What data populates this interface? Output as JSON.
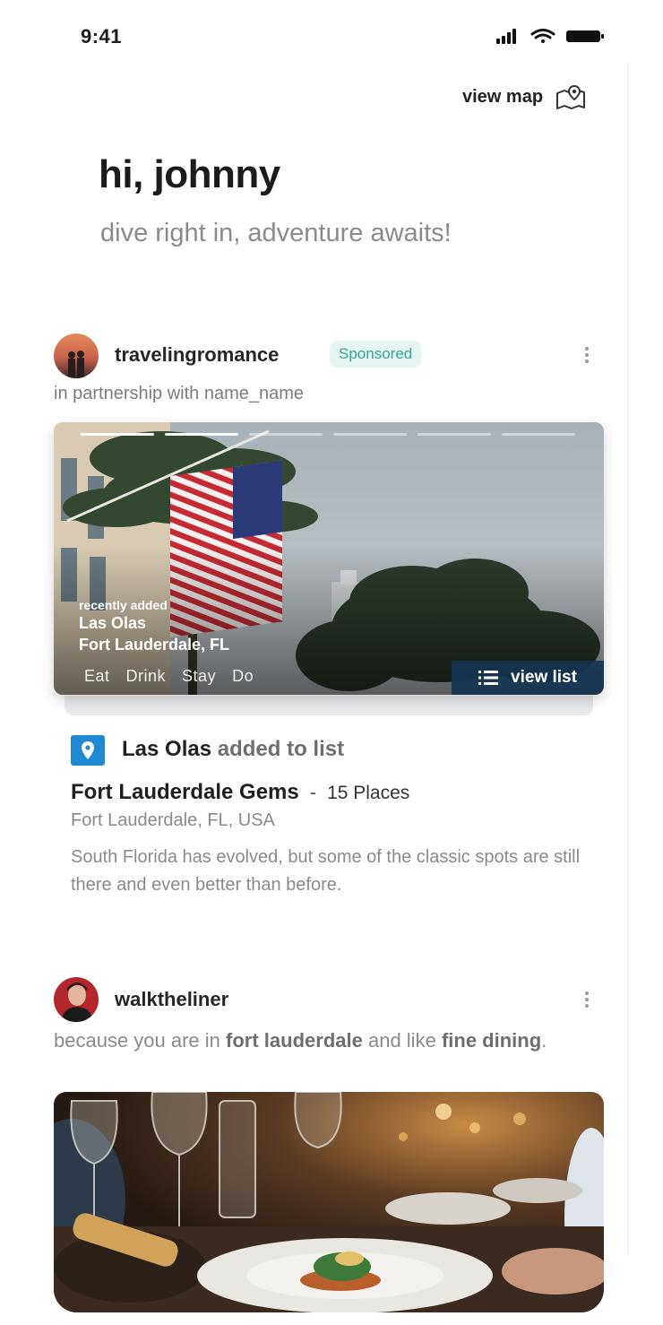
{
  "status_bar": {
    "time": "9:41"
  },
  "header": {
    "view_map_label": "view map"
  },
  "greeting": {
    "title": "hi, johnny",
    "subtitle": "dive right in, adventure awaits!"
  },
  "post1": {
    "username": "travelingromance",
    "badge": "Sponsored",
    "partnership": "in partnership with name_name",
    "hero": {
      "small_label": "recently added",
      "title": "Las Olas",
      "subtitle": "Fort Lauderdale, FL",
      "categories": [
        "Eat",
        "Drink",
        "Stay",
        "Do"
      ],
      "view_list_label": "view list",
      "story_segments": 6,
      "active_segments": 2
    },
    "activity": {
      "place": "Las Olas",
      "action": "added to list"
    },
    "list": {
      "name": "Fort Lauderdale Gems",
      "separator": "-",
      "count": "15 Places",
      "location": "Fort Lauderdale, FL, USA",
      "description": "South Florida has evolved, but some of the classic spots are still there and even better than before."
    }
  },
  "post2": {
    "username": "walktheliner",
    "reason_prefix": "because you are in",
    "reason_city": "fort lauderdale",
    "reason_mid": "and like",
    "reason_interest": "fine dining",
    "reason_suffix": "."
  },
  "colors": {
    "badge_bg": "#e5f5f1",
    "badge_text": "#37a48b",
    "pin_blue": "#1f8ad1",
    "view_list_bg": "#143452"
  }
}
